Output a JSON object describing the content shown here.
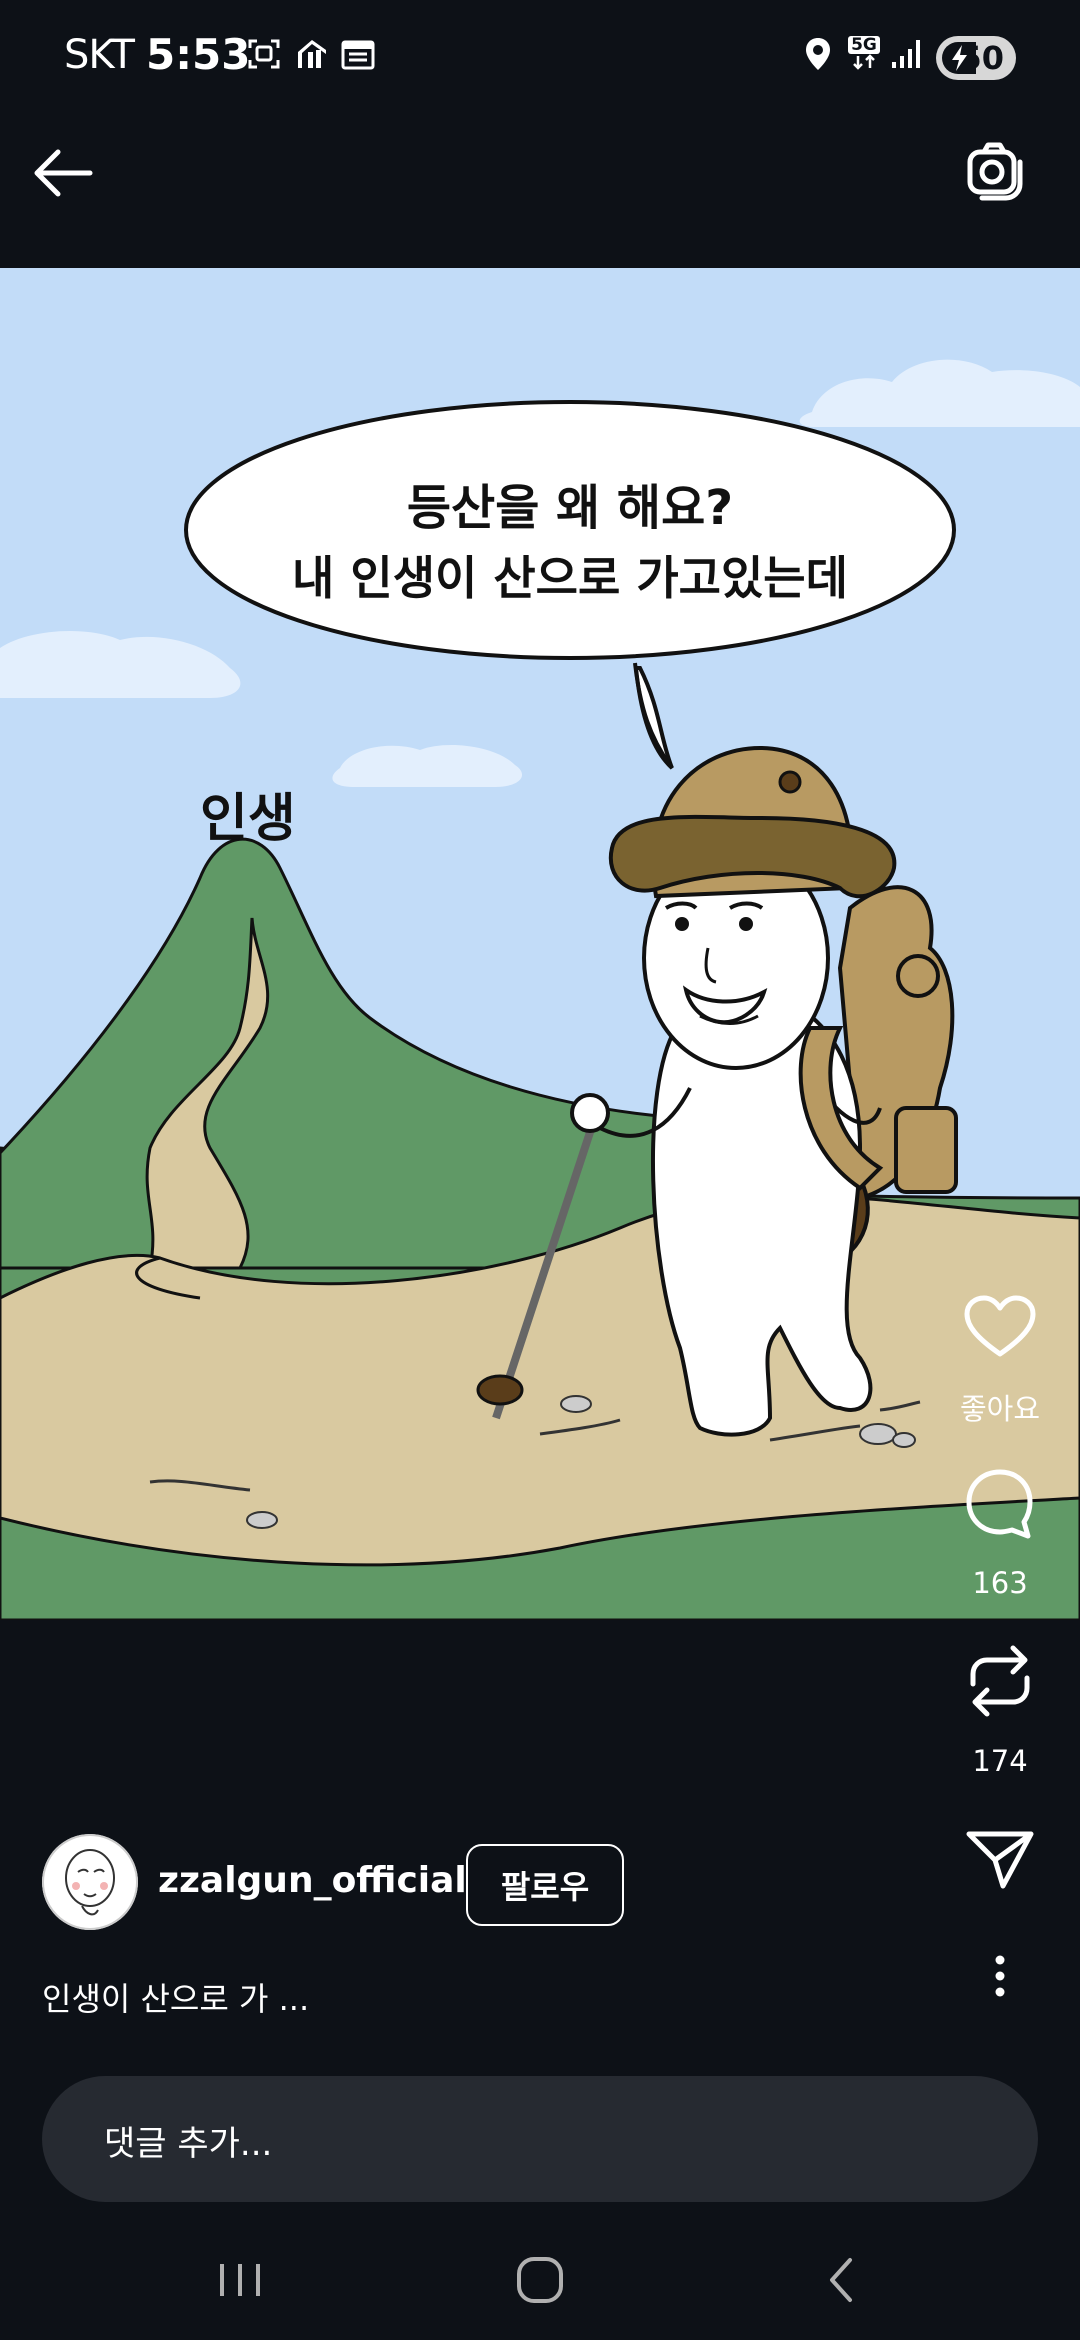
{
  "status_bar": {
    "carrier": "SKT",
    "time": "5:53",
    "network": "5G",
    "battery": "50",
    "icons": [
      "screenshot-icon",
      "app-notification-icon",
      "calendar-icon",
      "location-icon",
      "signal-icon",
      "battery-charging-icon"
    ]
  },
  "top_bar": {
    "back_icon": "back-arrow-icon",
    "camera_icon": "camera-icon"
  },
  "post": {
    "speech_line1": "등산을 왜 해요?",
    "speech_line2": "내 인생이 산으로 가고있는데",
    "mountain_label": "인생"
  },
  "actions": {
    "like_label": "좋아요",
    "comments_count": "163",
    "reposts_count": "174",
    "icons": [
      "heart-icon",
      "comment-icon",
      "repost-icon",
      "share-icon",
      "more-icon"
    ]
  },
  "author": {
    "username": "zzalgun_official",
    "follow_label": "팔로우"
  },
  "caption": "인생이 산으로 가 ...",
  "comment": {
    "placeholder": "댓글 추가..."
  },
  "nav": {
    "icons": [
      "recent-apps-icon",
      "home-icon",
      "back-icon"
    ]
  },
  "colors": {
    "background": "#0d1117",
    "sky": "#c2dcf8",
    "mountain": "#609966",
    "path": "#d9c9a0",
    "comment_bar": "#262a31"
  }
}
